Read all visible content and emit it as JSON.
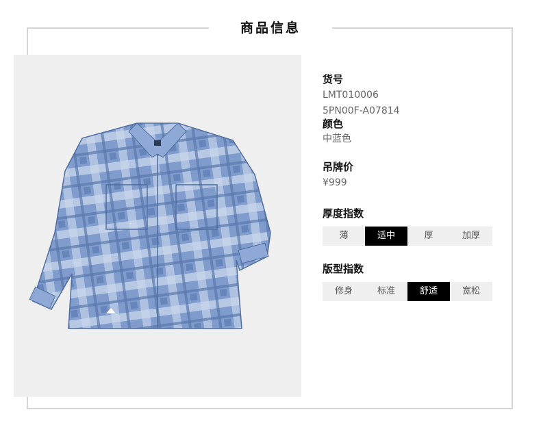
{
  "section_title": "商品信息",
  "product": {
    "sku_label": "货号",
    "sku_line1": "LMT010006",
    "sku_line2": "5PN00F-A07814",
    "color_label": "颜色",
    "color_value": "中蓝色",
    "price_label": "吊牌价",
    "price_value": "¥999"
  },
  "thickness": {
    "label": "厚度指数",
    "options": [
      "薄",
      "适中",
      "厚",
      "加厚"
    ],
    "selected": "适中"
  },
  "fit": {
    "label": "版型指数",
    "options": [
      "修身",
      "标准",
      "舒适",
      "宽松"
    ],
    "selected": "舒适"
  },
  "colors": {
    "shirt_base": "#7f9ccd",
    "shirt_dark": "#5a79ad",
    "shirt_light": "#c9d6ec",
    "panel_bg": "#efefef",
    "selected_bg": "#000000"
  },
  "image": {
    "depicts": "product-photo-denim-plaid-shirt"
  }
}
